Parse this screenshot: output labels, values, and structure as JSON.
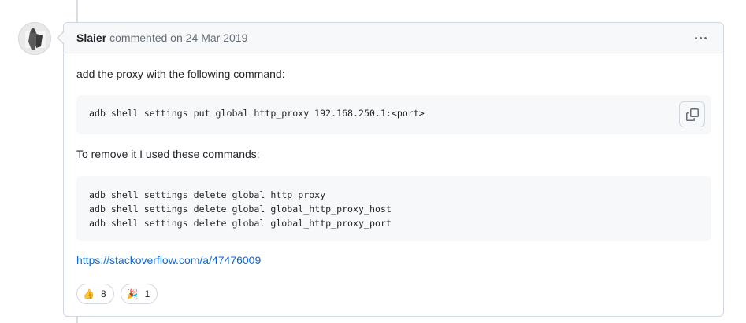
{
  "comment": {
    "author": "Slaier",
    "action": "commented on",
    "date": "24 Mar 2019",
    "paragraph1": "add the proxy with the following command:",
    "code1": "adb shell settings put global http_proxy 192.168.250.1:<port>",
    "paragraph2": "To remove it I used these commands:",
    "code2_lines": [
      "adb shell settings delete global http_proxy",
      "adb shell settings delete global global_http_proxy_host",
      "adb shell settings delete global global_http_proxy_port"
    ],
    "link_text": "https://stackoverflow.com/a/47476009",
    "reactions": [
      {
        "emoji": "👍",
        "icon": "thumbs-up-icon",
        "count": "8"
      },
      {
        "emoji": "🎉",
        "icon": "hooray-icon",
        "count": "1"
      }
    ]
  },
  "colors": {
    "accent_link": "#0969da",
    "border": "#d0d7de",
    "header_bg": "#f6f8fa"
  }
}
